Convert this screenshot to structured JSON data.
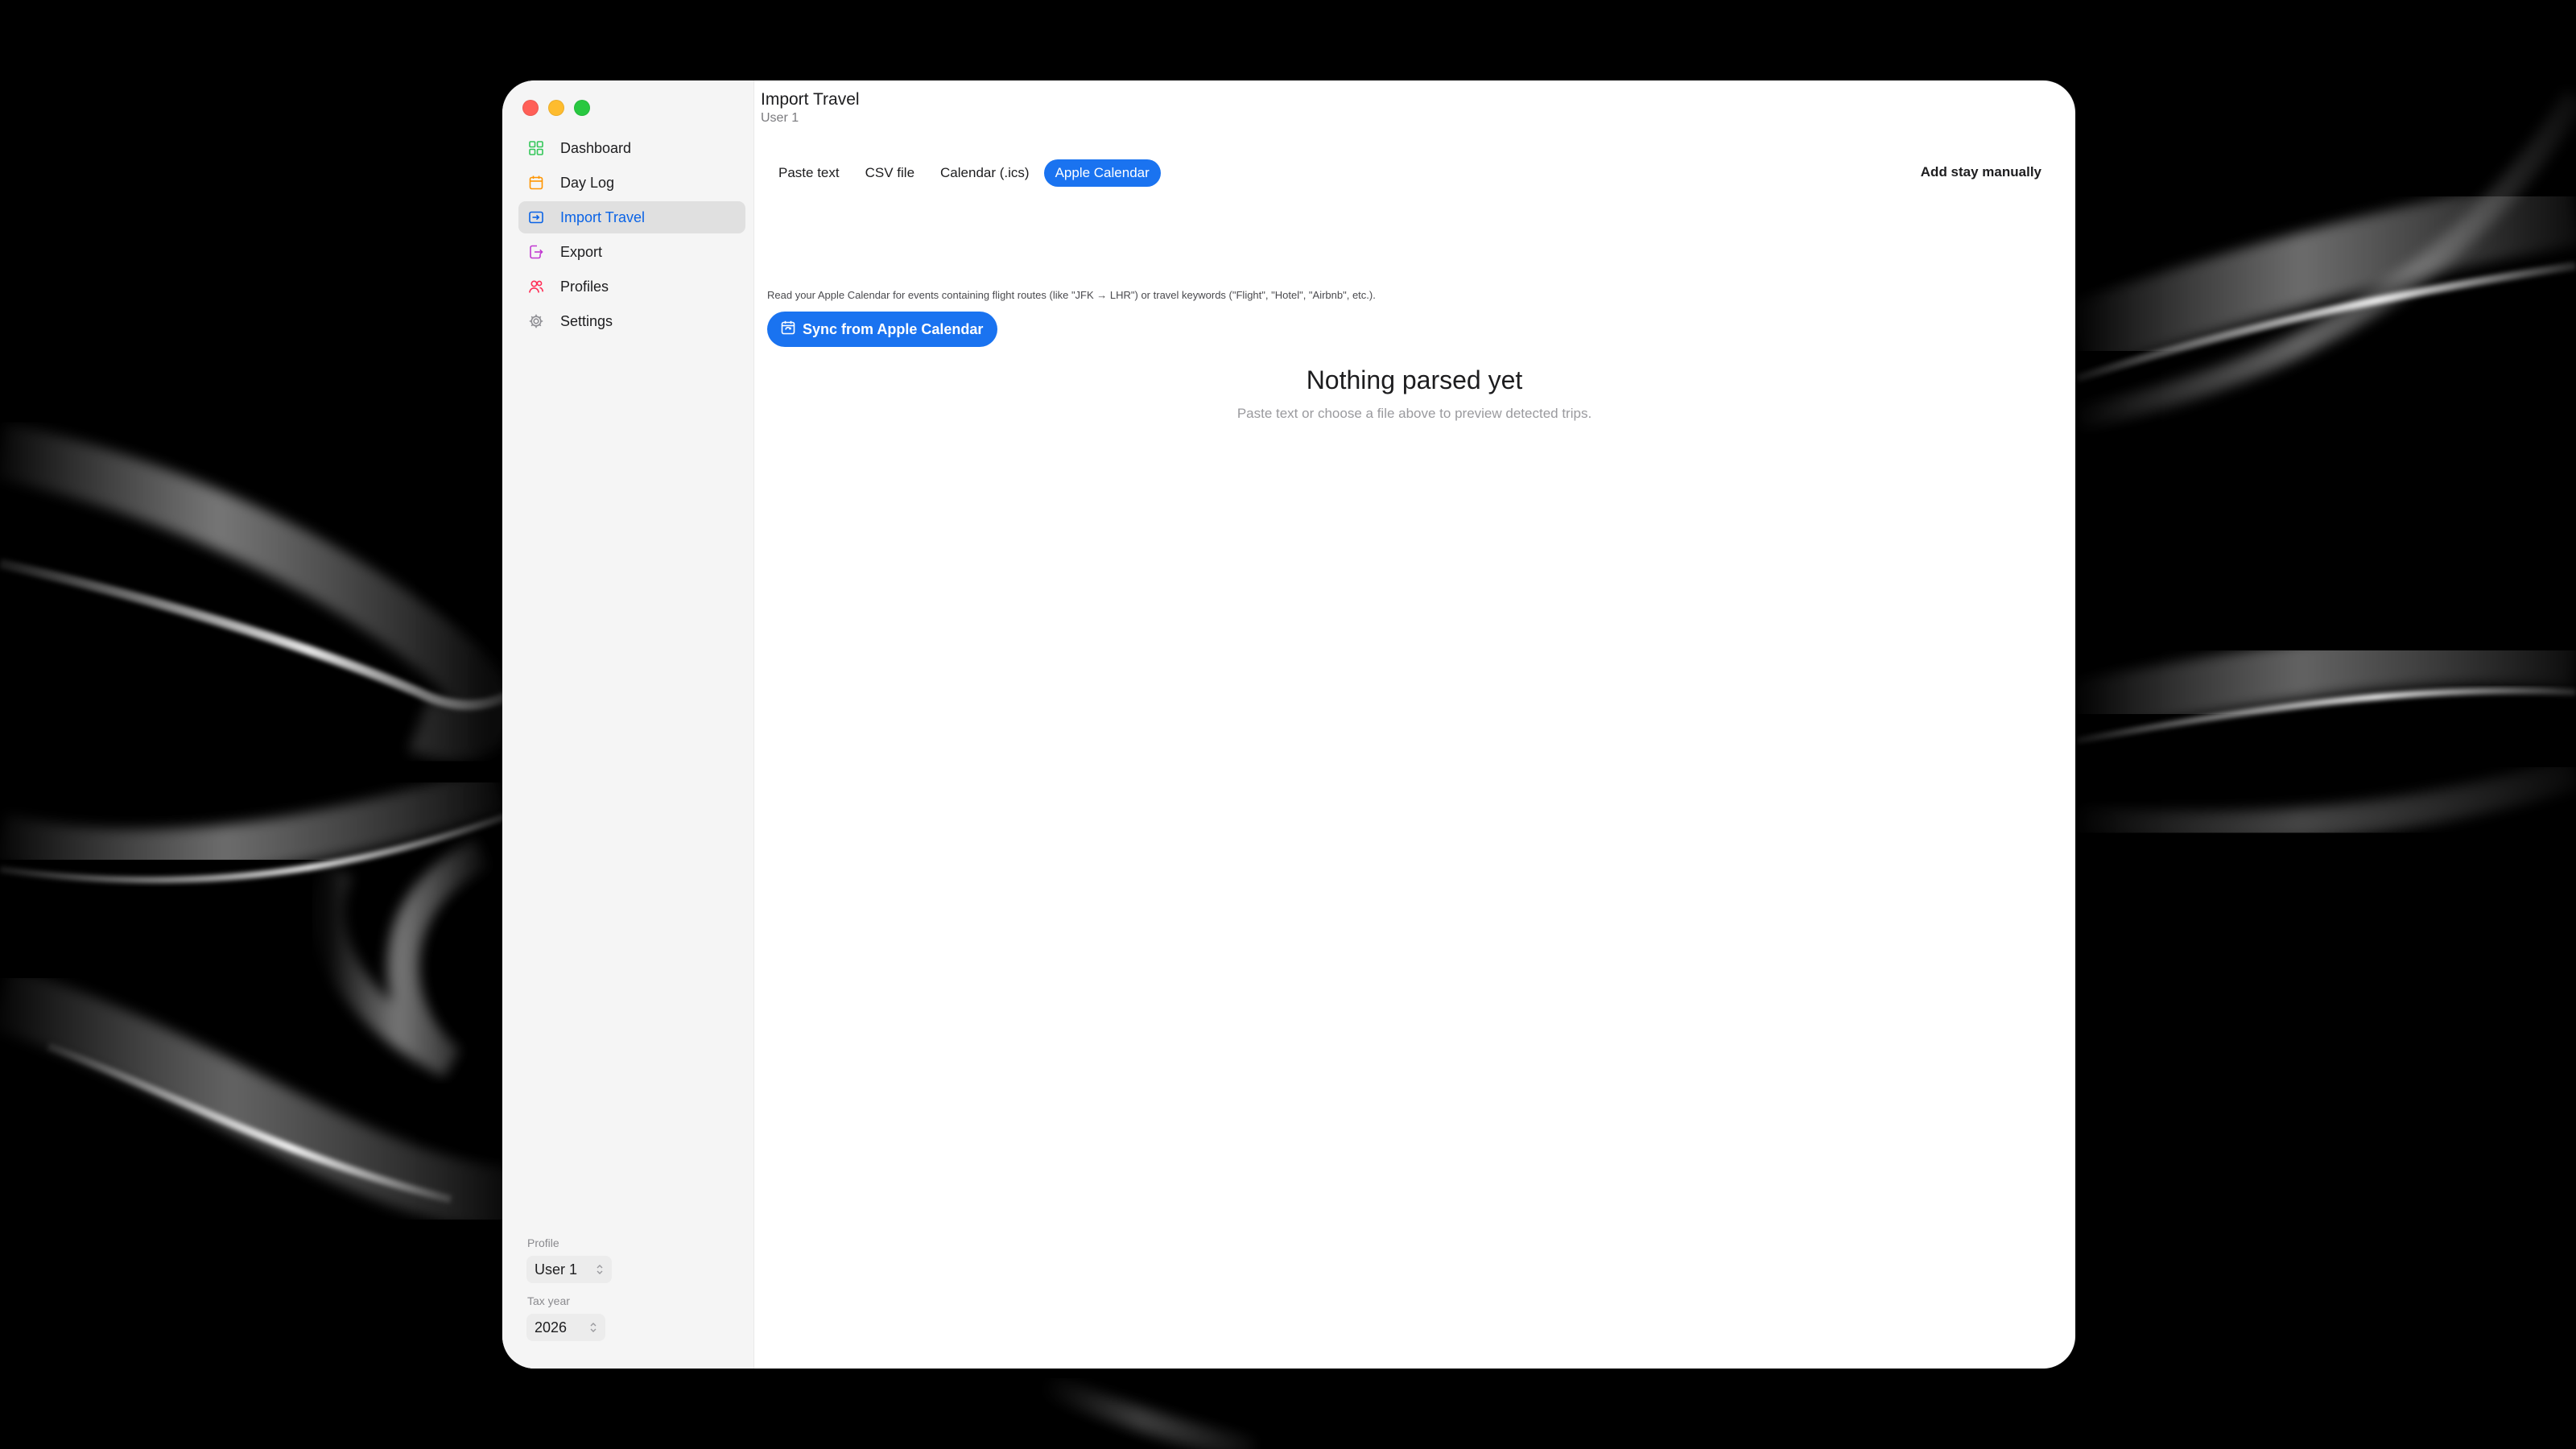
{
  "colors": {
    "accent": "#1a73f0",
    "active_text": "#0a63e6",
    "close": "#ff5f57",
    "minimize": "#febc2e",
    "maximize": "#28c840"
  },
  "sidebar": {
    "items": [
      {
        "label": "Dashboard",
        "icon": "dashboard-icon",
        "color": "#34c759"
      },
      {
        "label": "Day Log",
        "icon": "calendar-icon",
        "color": "#ff9500"
      },
      {
        "label": "Import Travel",
        "icon": "import-icon",
        "color": "#0a63e6",
        "active": true
      },
      {
        "label": "Export",
        "icon": "export-icon",
        "color": "#c13ad1"
      },
      {
        "label": "Profiles",
        "icon": "people-icon",
        "color": "#ff2d55"
      },
      {
        "label": "Settings",
        "icon": "gear-icon",
        "color": "#8e8e93"
      }
    ],
    "profile_label": "Profile",
    "profile_value": "User 1",
    "tax_year_label": "Tax year",
    "tax_year_value": "2026"
  },
  "header": {
    "title": "Import Travel",
    "subtitle": "User 1"
  },
  "tabs": [
    {
      "label": "Paste text"
    },
    {
      "label": "CSV file"
    },
    {
      "label": "Calendar (.ics)"
    },
    {
      "label": "Apple Calendar",
      "active": true
    }
  ],
  "toolbar": {
    "add_stay_label": "Add stay manually"
  },
  "main": {
    "info_text": "Read your Apple Calendar for events containing flight routes (like \"JFK → LHR\") or travel keywords (\"Flight\", \"Hotel\", \"Airbnb\", etc.).",
    "sync_label": "Sync from Apple Calendar",
    "sync_icon": "calendar-sync-icon",
    "empty_title": "Nothing parsed yet",
    "empty_subtitle": "Paste text or choose a file above to preview detected trips."
  }
}
